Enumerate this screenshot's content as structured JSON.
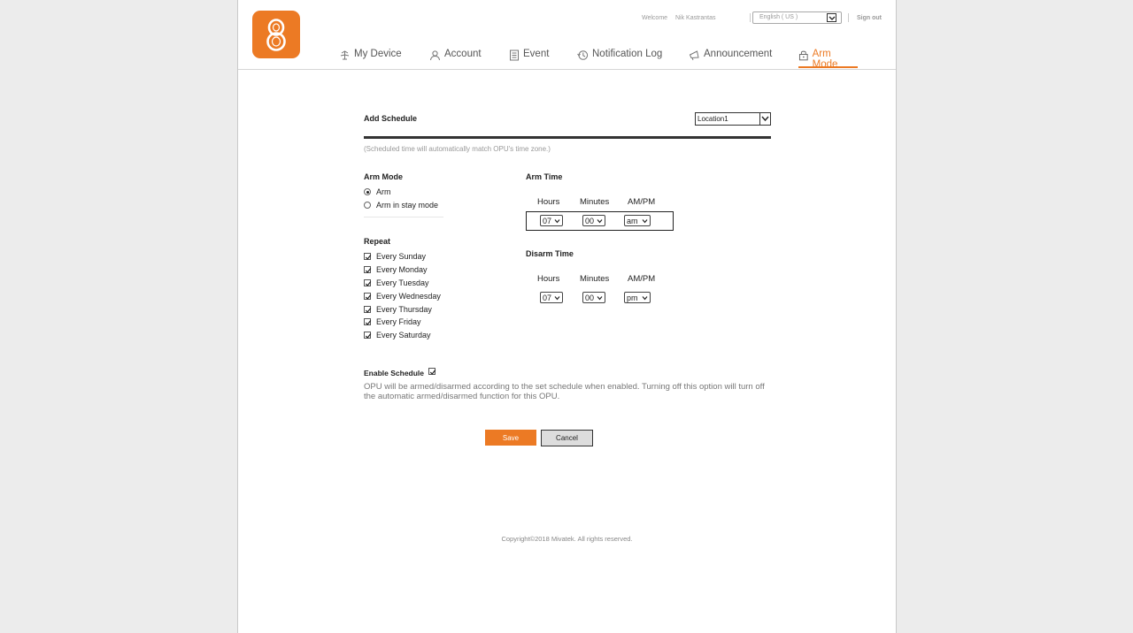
{
  "header": {
    "welcome": "Welcome",
    "username": "Nik Kastrantas",
    "language": "English ( US )",
    "sign_out": "Sign out",
    "accent": "#ec7a24"
  },
  "nav": {
    "items": [
      {
        "label": "My Device",
        "icon": "device-icon"
      },
      {
        "label": "Account",
        "icon": "account-icon"
      },
      {
        "label": "Event",
        "icon": "event-icon"
      },
      {
        "label": "Notification Log",
        "icon": "notification-log-icon"
      },
      {
        "label": "Announcement",
        "icon": "announcement-icon"
      },
      {
        "label": "Arm Mode",
        "icon": "lock-icon",
        "active": true
      }
    ]
  },
  "schedule": {
    "title": "Add Schedule",
    "location": "Location1",
    "note": "(Scheduled time will automatically match OPU's time zone.)",
    "arm_mode": {
      "title": "Arm Mode",
      "options": [
        "Arm",
        "Arm in stay mode"
      ],
      "selected": "Arm"
    },
    "repeat": {
      "title": "Repeat",
      "days": [
        "Every Sunday",
        "Every Monday",
        "Every Tuesday",
        "Every Wednesday",
        "Every Thursday",
        "Every Friday",
        "Every Saturday"
      ],
      "checked": [
        true,
        true,
        true,
        true,
        true,
        true,
        true
      ]
    },
    "arm_time": {
      "title": "Arm Time",
      "headers": [
        "Hours",
        "Minutes",
        "AM/PM"
      ],
      "hours": "07",
      "minutes": "00",
      "ampm": "am"
    },
    "disarm_time": {
      "title": "Disarm Time",
      "headers": [
        "Hours",
        "Minutes",
        "AM/PM"
      ],
      "hours": "07",
      "minutes": "00",
      "ampm": "pm"
    },
    "enable": {
      "label": "Enable Schedule",
      "checked": true,
      "description": "OPU will be armed/disarmed according to the set schedule when enabled. Turning off this option will turn off the automatic armed/disarmed function for this OPU."
    },
    "save_label": "Save",
    "cancel_label": "Cancel"
  },
  "footer": {
    "copyright": "Copyright©2018 Mivatek. All rights reserved."
  }
}
